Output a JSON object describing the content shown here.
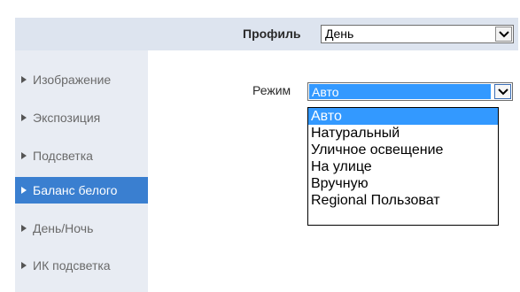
{
  "profile": {
    "label": "Профиль",
    "value": "День"
  },
  "sidebar": {
    "items": [
      {
        "label": "Изображение",
        "active": false
      },
      {
        "label": "Экспозиция",
        "active": false
      },
      {
        "label": "Подсветка",
        "active": false
      },
      {
        "label": "Баланс белого",
        "active": true
      },
      {
        "label": "День/Ночь",
        "active": false
      },
      {
        "label": "ИК подсветка",
        "active": false
      }
    ]
  },
  "mode": {
    "label": "Режим",
    "value": "Авто",
    "options": [
      "Авто",
      "Натуральный",
      "Уличное освещение",
      "На улице",
      "Вручную",
      "Regional Пользоват"
    ],
    "selected_index": 0
  },
  "colors": {
    "accent": "#3a7fd0",
    "selection": "#3399ff",
    "sidebar_bg": "#e8ecf3",
    "header_bg": "#dde4ef"
  }
}
